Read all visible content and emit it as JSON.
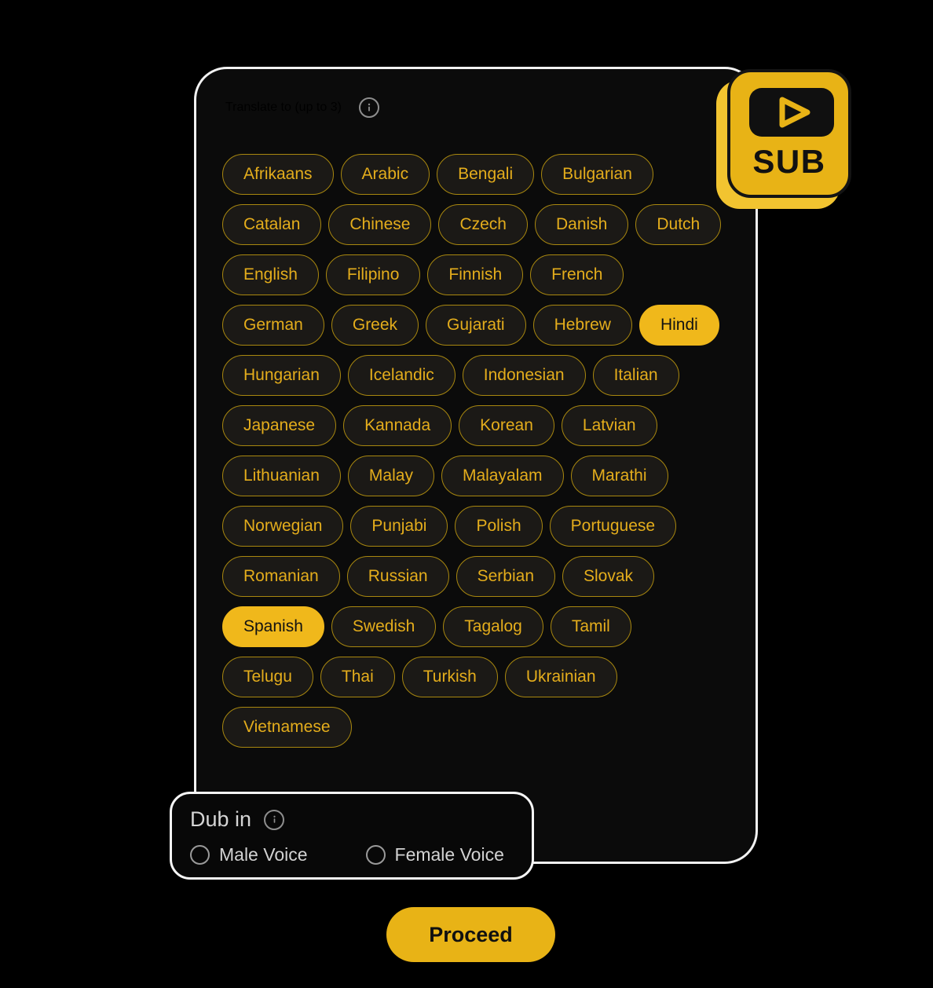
{
  "translate_panel": {
    "title": "Translate to (up to 3)",
    "info_icon": "info-icon",
    "languages": [
      {
        "label": "Afrikaans",
        "selected": false
      },
      {
        "label": "Arabic",
        "selected": false
      },
      {
        "label": "Bengali",
        "selected": false
      },
      {
        "label": "Bulgarian",
        "selected": false
      },
      {
        "label": "Catalan",
        "selected": false
      },
      {
        "label": "Chinese",
        "selected": false
      },
      {
        "label": "Czech",
        "selected": false
      },
      {
        "label": "Danish",
        "selected": false
      },
      {
        "label": "Dutch",
        "selected": false
      },
      {
        "label": "English",
        "selected": false
      },
      {
        "label": "Filipino",
        "selected": false
      },
      {
        "label": "Finnish",
        "selected": false
      },
      {
        "label": "French",
        "selected": false
      },
      {
        "label": "German",
        "selected": false
      },
      {
        "label": "Greek",
        "selected": false
      },
      {
        "label": "Gujarati",
        "selected": false
      },
      {
        "label": "Hebrew",
        "selected": false
      },
      {
        "label": "Hindi",
        "selected": true
      },
      {
        "label": "Hungarian",
        "selected": false
      },
      {
        "label": "Icelandic",
        "selected": false
      },
      {
        "label": "Indonesian",
        "selected": false
      },
      {
        "label": "Italian",
        "selected": false
      },
      {
        "label": "Japanese",
        "selected": false
      },
      {
        "label": "Kannada",
        "selected": false
      },
      {
        "label": "Korean",
        "selected": false
      },
      {
        "label": "Latvian",
        "selected": false
      },
      {
        "label": "Lithuanian",
        "selected": false
      },
      {
        "label": "Malay",
        "selected": false
      },
      {
        "label": "Malayalam",
        "selected": false
      },
      {
        "label": "Marathi",
        "selected": false
      },
      {
        "label": "Norwegian",
        "selected": false
      },
      {
        "label": "Punjabi",
        "selected": false
      },
      {
        "label": "Polish",
        "selected": false
      },
      {
        "label": "Portuguese",
        "selected": false
      },
      {
        "label": "Romanian",
        "selected": false
      },
      {
        "label": "Russian",
        "selected": false
      },
      {
        "label": "Serbian",
        "selected": false
      },
      {
        "label": "Slovak",
        "selected": false
      },
      {
        "label": "Spanish",
        "selected": true
      },
      {
        "label": "Swedish",
        "selected": false
      },
      {
        "label": "Tagalog",
        "selected": false
      },
      {
        "label": "Tamil",
        "selected": false
      },
      {
        "label": "Telugu",
        "selected": false
      },
      {
        "label": "Thai",
        "selected": false
      },
      {
        "label": "Turkish",
        "selected": false
      },
      {
        "label": "Ukrainian",
        "selected": false
      },
      {
        "label": "Vietnamese",
        "selected": false
      }
    ]
  },
  "sub_badge": {
    "label": "SUB",
    "play_icon": "play-triangle-icon"
  },
  "dub_panel": {
    "title": "Dub in",
    "info_icon": "info-icon",
    "options": [
      {
        "label": "Male Voice",
        "selected": false
      },
      {
        "label": "Female Voice",
        "selected": false
      }
    ]
  },
  "actions": {
    "proceed_label": "Proceed"
  },
  "colors": {
    "accent_gold": "#e8b316",
    "pill_border": "#a8870f",
    "pill_text": "#e4ad1c",
    "pill_background": "#1b1916",
    "card_background": "#0b0b0b",
    "card_border": "#f2f2f2",
    "page_background": "#000000",
    "muted_text": "#d5d5d5"
  }
}
